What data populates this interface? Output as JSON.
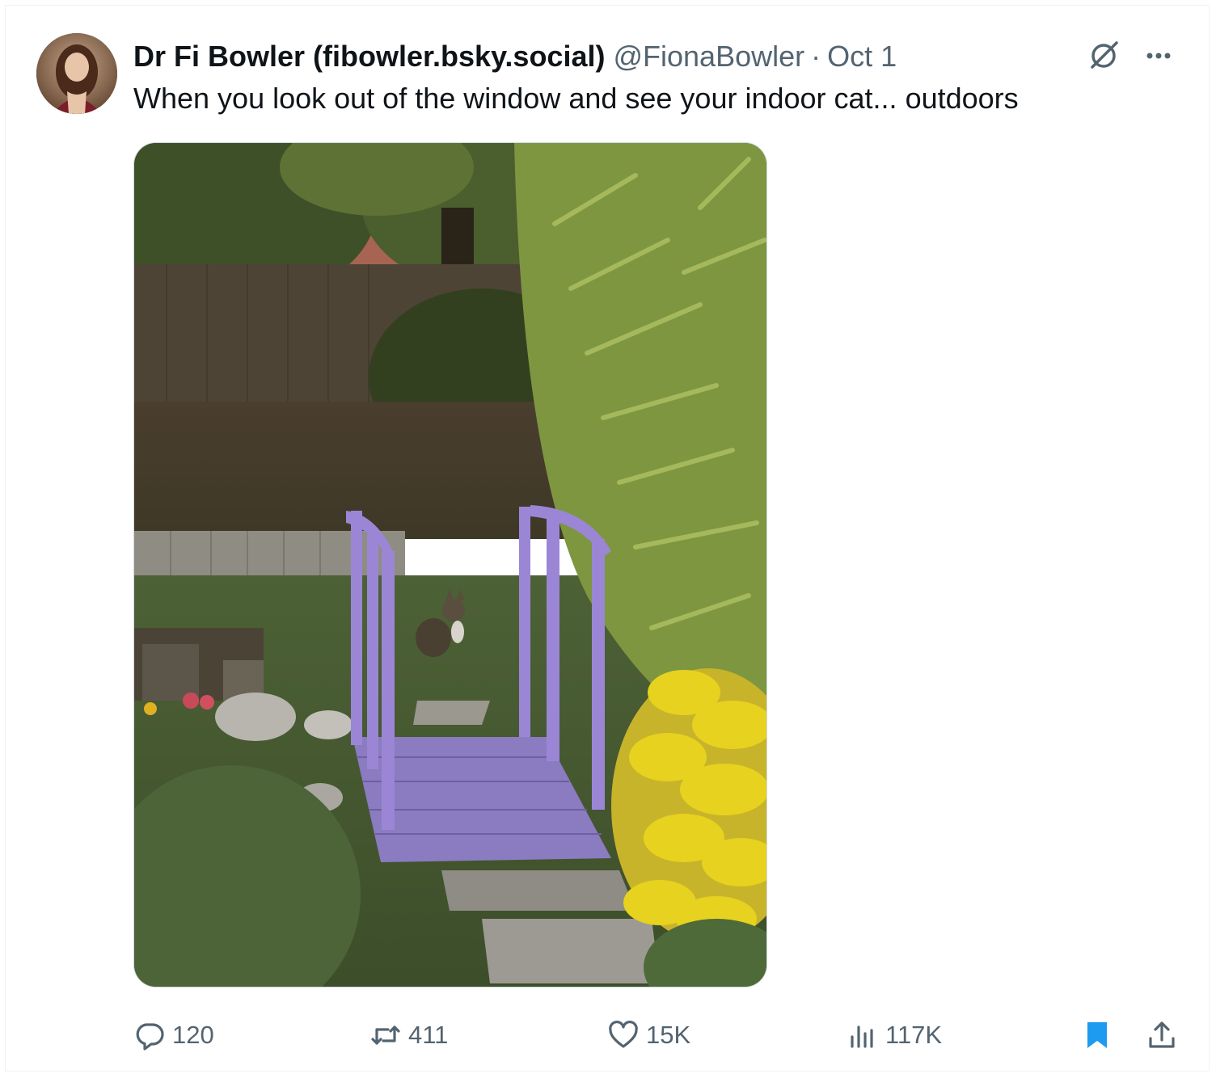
{
  "tweet": {
    "display_name": "Dr Fi Bowler (fibowler.bsky.social)",
    "handle": "@FionaBowler",
    "separator": "·",
    "date": "Oct 1",
    "text": "When you look out of the window and see your indoor cat... outdoors"
  },
  "icons": {
    "grok": "grok-slash-icon",
    "more": "more-dots-icon",
    "reply": "speech-bubble-icon",
    "retweet": "retweet-arrows-icon",
    "like": "heart-icon",
    "views": "bar-chart-icon",
    "bookmark": "bookmark-filled-icon",
    "share": "share-upload-icon"
  },
  "actions": {
    "replies": "120",
    "reposts": "411",
    "likes": "15K",
    "views": "117K"
  },
  "colors": {
    "text": "#0f1419",
    "secondary": "#536471",
    "accent": "#1d9bf0",
    "bridge": "#9b86d6",
    "foliage_yellow": "#e6d21f"
  }
}
